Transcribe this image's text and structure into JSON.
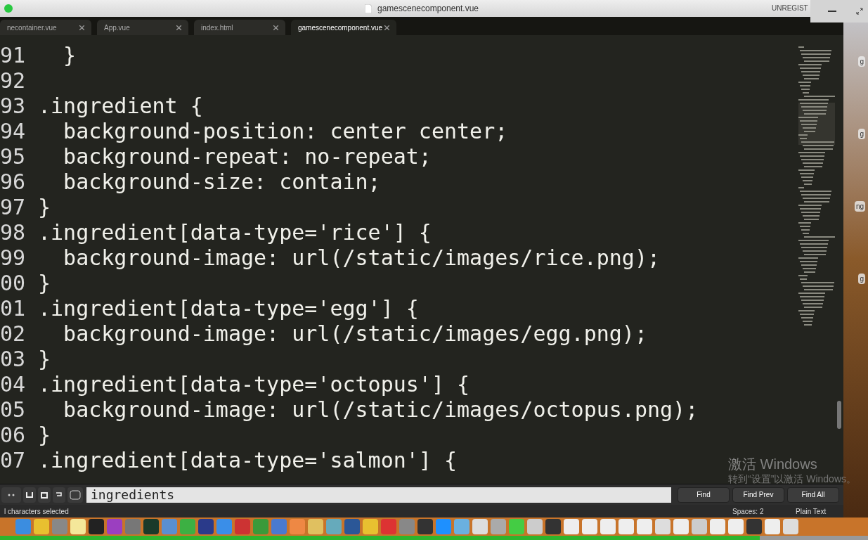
{
  "window": {
    "title": "gamescenecomponent.vue",
    "license": "UNREGIST"
  },
  "tabs": [
    {
      "label": "necontainer.vue",
      "selected": false
    },
    {
      "label": "App.vue",
      "selected": false
    },
    {
      "label": "index.html",
      "selected": false
    },
    {
      "label": "gamescenecomponent.vue",
      "selected": true
    }
  ],
  "editor": {
    "lines": [
      {
        "number": "91",
        "text": "  }"
      },
      {
        "number": "92"
      },
      {
        "number": "93",
        "text": ".ingredient {"
      },
      {
        "number": "94",
        "text": "  background-position: center center;"
      },
      {
        "number": "95",
        "text": "  background-repeat: no-repeat;"
      },
      {
        "number": "96",
        "text": "  background-size: contain;"
      },
      {
        "number": "97",
        "text": "}"
      },
      {
        "number": "98",
        "text": ".ingredient[data-type='rice'] {"
      },
      {
        "number": "99",
        "text": "  background-image: url(/static/images/rice.png);"
      },
      {
        "number": "00",
        "text": "}"
      },
      {
        "number": "01",
        "text": ".ingredient[data-type='egg'] {"
      },
      {
        "number": "02",
        "text": "  background-image: url(/static/images/egg.png);"
      },
      {
        "number": "03",
        "text": "}"
      },
      {
        "number": "04",
        "text": ".ingredient[data-type='octopus'] {"
      },
      {
        "number": "05",
        "text": "  background-image: url(/static/images/octopus.png);"
      },
      {
        "number": "06",
        "text": "}"
      },
      {
        "number": "07",
        "text": ".ingredient[data-type='salmon'] {"
      }
    ]
  },
  "find_panel": {
    "value": "ingredients",
    "buttons": [
      "Find",
      "Find Prev",
      "Find All"
    ]
  },
  "status_bar": {
    "selection": "l characters selected",
    "indentation": "Spaces: 2",
    "syntax": "Plain Text"
  },
  "activation_notice": {
    "title": "激活 Windows",
    "subtitle": "转到“设置”以激活 Windows。"
  },
  "desktop_labels": [
    "g",
    "g",
    "ng",
    "g"
  ],
  "video_progress": {
    "level": 0.875
  }
}
